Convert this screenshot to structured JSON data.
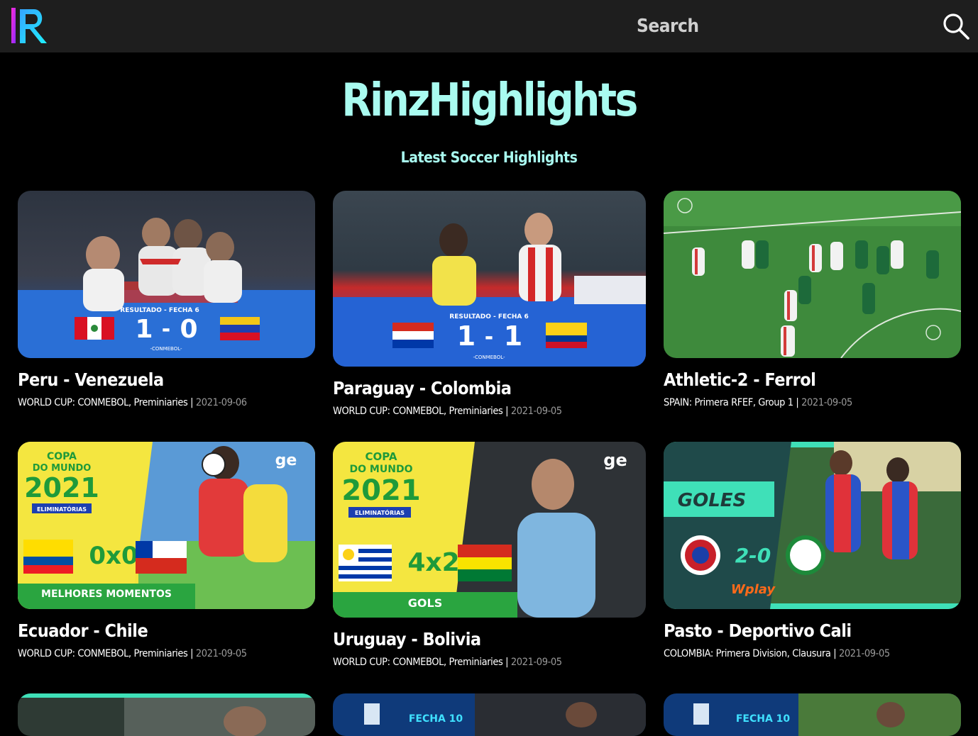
{
  "header": {
    "search_placeholder": "Search",
    "logo_letter": "R"
  },
  "hero": {
    "title": "RinzHighlights",
    "subtitle": "Latest Soccer Highlights"
  },
  "cards": [
    {
      "title": "Peru - Venezuela",
      "competition": "WORLD CUP: CONMEBOL, Preminiaries |",
      "date": "2021-09-06",
      "thumb_text": {
        "label": "RESULTADO - FECHA 6",
        "score_left": "1",
        "score_right": "0",
        "org": "-CONMEBOL-"
      }
    },
    {
      "title": "Paraguay - Colombia",
      "competition": "WORLD CUP: CONMEBOL, Preminiaries |",
      "date": "2021-09-05",
      "thumb_text": {
        "label": "RESULTADO - FECHA 6",
        "score_left": "1",
        "score_right": "1",
        "org": "-CONMEBOL-"
      }
    },
    {
      "title": "Athletic-2 - Ferrol",
      "competition": "SPAIN: Primera RFEF, Group 1 |",
      "date": "2021-09-05",
      "thumb_text": {}
    },
    {
      "title": "Ecuador - Chile",
      "competition": "WORLD CUP: CONMEBOL, Preminiaries |",
      "date": "2021-09-05",
      "thumb_text": {
        "line1": "COPA",
        "line2": "DO MUNDO",
        "year": "2021",
        "badge": "ELIMINATÓRIAS",
        "score": "0x0",
        "footer": "MELHORES MOMENTOS",
        "brand": "ge"
      }
    },
    {
      "title": "Uruguay - Bolivia",
      "competition": "WORLD CUP: CONMEBOL, Preminiaries |",
      "date": "2021-09-05",
      "thumb_text": {
        "line1": "COPA",
        "line2": "DO MUNDO",
        "year": "2021",
        "badge": "ELIMINATÓRIAS",
        "score": "4x2",
        "footer": "GOLS",
        "brand": "ge"
      }
    },
    {
      "title": "Pasto - Deportivo Cali",
      "competition": "COLOMBIA: Primera Division, Clausura |",
      "date": "2021-09-05",
      "thumb_text": {
        "label": "GOLES",
        "score": "2-0",
        "sponsor": "Wplay"
      }
    }
  ],
  "partial_cards": [
    {
      "thumb_text": ""
    },
    {
      "thumb_text": "FECHA 10"
    },
    {
      "thumb_text": "FECHA 10"
    }
  ],
  "colors": {
    "accent": "#a9fbf0",
    "header_bg": "#1e1e1e",
    "page_bg": "#000000",
    "date": "#9a9a9a"
  },
  "icons": {
    "logo": "rinz-r-logo",
    "search": "magnifier-icon"
  }
}
